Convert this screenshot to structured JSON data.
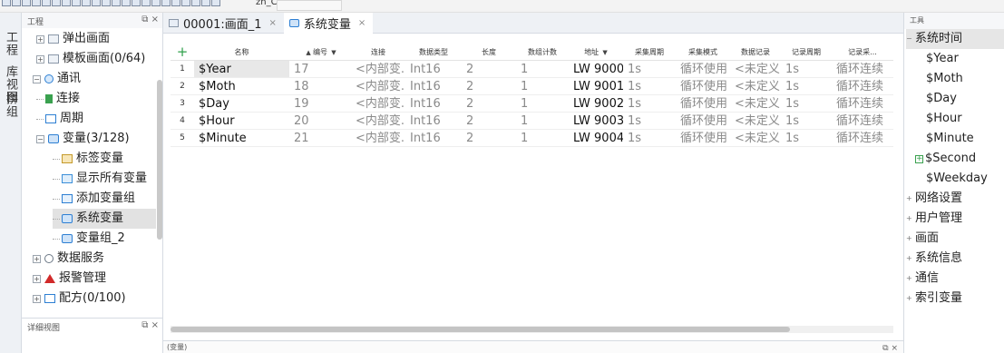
{
  "toolbar": {
    "language": "zh_CN"
  },
  "left_rail": {
    "tabs": [
      "工程",
      "库视图",
      "拼组"
    ]
  },
  "tree_panel": {
    "title": "工程",
    "float_icon": "restore-icon",
    "close_icon": "×"
  },
  "tree": [
    {
      "label": "弹出画面",
      "level": 1,
      "expander": "+",
      "icon": "screen-icon"
    },
    {
      "label": "模板画面(0/64)",
      "level": 1,
      "expander": "+",
      "icon": "screen-icon"
    },
    {
      "label": "通讯",
      "level": 0,
      "expander": "−",
      "icon": "globe-icon"
    },
    {
      "label": "连接",
      "level": 1,
      "expander": "",
      "icon": "connection-icon"
    },
    {
      "label": "周期",
      "level": 1,
      "expander": "",
      "icon": "cycle-icon"
    },
    {
      "label": "变量(3/128)",
      "level": 1,
      "expander": "−",
      "icon": "variable-icon"
    },
    {
      "label": "标签变量",
      "level": 2,
      "expander": "",
      "icon": "tag-icon"
    },
    {
      "label": "显示所有变量",
      "level": 2,
      "expander": "",
      "icon": "list-icon"
    },
    {
      "label": "添加变量组",
      "level": 2,
      "expander": "",
      "icon": "add-group-icon"
    },
    {
      "label": "系统变量",
      "level": 2,
      "expander": "",
      "icon": "variable-icon",
      "selected": true
    },
    {
      "label": "变量组_2",
      "level": 2,
      "expander": "",
      "icon": "variable-icon"
    },
    {
      "label": "数据服务",
      "level": 0,
      "expander": "+",
      "icon": "database-icon"
    },
    {
      "label": "报警管理",
      "level": 0,
      "expander": "+",
      "icon": "alarm-icon"
    },
    {
      "label": "配方(0/100)",
      "level": 0,
      "expander": "+",
      "icon": "recipe-icon"
    }
  ],
  "detail_panel": {
    "title": "详细视图"
  },
  "tabs": [
    {
      "label": "00001:画面_1",
      "icon": "screen-icon",
      "active": false
    },
    {
      "label": "系统变量",
      "icon": "variable-icon",
      "active": true
    }
  ],
  "grid": {
    "columns": [
      {
        "label": "+",
        "key": "add"
      },
      {
        "label": "名称",
        "key": "name"
      },
      {
        "label": "编号",
        "key": "num",
        "sort": "▲",
        "filter": "▼"
      },
      {
        "label": "连接",
        "key": "conn"
      },
      {
        "label": "数据类型",
        "key": "type"
      },
      {
        "label": "长度",
        "key": "len"
      },
      {
        "label": "数组计数",
        "key": "count"
      },
      {
        "label": "地址",
        "key": "addr",
        "filter": "▼"
      },
      {
        "label": "采集周期",
        "key": "cycle"
      },
      {
        "label": "采集模式",
        "key": "mode"
      },
      {
        "label": "数据记录",
        "key": "log"
      },
      {
        "label": "记录周期",
        "key": "logcycle"
      },
      {
        "label": "记录采...",
        "key": "logmode"
      }
    ],
    "rows": [
      {
        "idx": "1",
        "name": "$Year",
        "num": "17",
        "conn": "<内部变...",
        "type": "Int16",
        "len": "2",
        "count": "1",
        "addr": "LW 9000",
        "cycle": "1s",
        "mode": "循环使用",
        "log": "<未定义>",
        "logcycle": "1s",
        "logmode": "循环连续"
      },
      {
        "idx": "2",
        "name": "$Moth",
        "num": "18",
        "conn": "<内部变...",
        "type": "Int16",
        "len": "2",
        "count": "1",
        "addr": "LW 9001",
        "cycle": "1s",
        "mode": "循环使用",
        "log": "<未定义>",
        "logcycle": "1s",
        "logmode": "循环连续"
      },
      {
        "idx": "3",
        "name": "$Day",
        "num": "19",
        "conn": "<内部变...",
        "type": "Int16",
        "len": "2",
        "count": "1",
        "addr": "LW 9002",
        "cycle": "1s",
        "mode": "循环使用",
        "log": "<未定义>",
        "logcycle": "1s",
        "logmode": "循环连续"
      },
      {
        "idx": "4",
        "name": "$Hour",
        "num": "20",
        "conn": "<内部变...",
        "type": "Int16",
        "len": "2",
        "count": "1",
        "addr": "LW 9003",
        "cycle": "1s",
        "mode": "循环使用",
        "log": "<未定义>",
        "logcycle": "1s",
        "logmode": "循环连续"
      },
      {
        "idx": "5",
        "name": "$Minute",
        "num": "21",
        "conn": "<内部变...",
        "type": "Int16",
        "len": "2",
        "count": "1",
        "addr": "LW 9004",
        "cycle": "1s",
        "mode": "循环使用",
        "log": "<未定义>",
        "logcycle": "1s",
        "logmode": "循环连续"
      }
    ]
  },
  "status_bar": {
    "label": "(变量)"
  },
  "right_panel": {
    "title": "工具",
    "items": [
      {
        "label": "系统时间",
        "expander": "−",
        "selected": true
      },
      {
        "label": "$Year",
        "child": true
      },
      {
        "label": "$Moth",
        "child": true
      },
      {
        "label": "$Day",
        "child": true
      },
      {
        "label": "$Hour",
        "child": true
      },
      {
        "label": "$Minute",
        "child": true
      },
      {
        "label": "$Second",
        "child": true,
        "plus": true
      },
      {
        "label": "$Weekday",
        "child": true
      },
      {
        "label": "网络设置",
        "expander": "+"
      },
      {
        "label": "用户管理",
        "expander": "+"
      },
      {
        "label": "画面",
        "expander": "+"
      },
      {
        "label": "系统信息",
        "expander": "+"
      },
      {
        "label": "通信",
        "expander": "+"
      },
      {
        "label": "索引变量",
        "expander": "+"
      }
    ]
  },
  "colors": {
    "accent_green": "#2fa04b",
    "alarm_red": "#d12a2a",
    "tab_blue": "#2d7fd3"
  }
}
